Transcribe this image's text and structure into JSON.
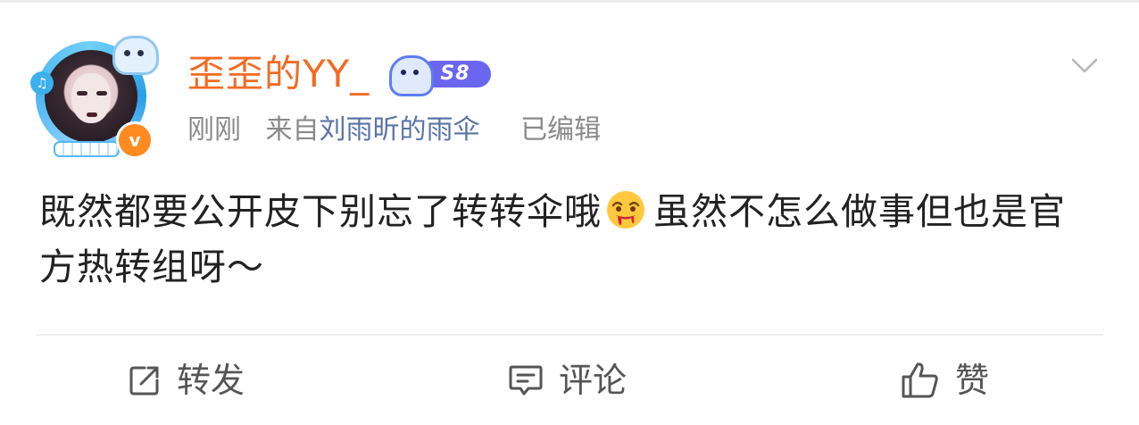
{
  "post": {
    "user": {
      "name": "歪歪的YY_",
      "level": "S8",
      "verified_badge": "v"
    },
    "meta": {
      "time": "刚刚",
      "from_prefix": "来自",
      "source": "刘雨昕的雨伞",
      "edited": "已编辑"
    },
    "content_part1": "既然都要公开皮下别忘了转转伞哦",
    "content_emoji": "drooling-face-emoji",
    "content_part2": "虽然不怎么做事但也是官方热转组呀～",
    "actions": {
      "repost_label": "转发",
      "comment_label": "评论",
      "like_label": "赞"
    }
  },
  "colors": {
    "username": "#f26b22",
    "meta": "#8a8a8a",
    "source_link": "#5a74a6",
    "level_pill": "#6b66ef",
    "verified_badge": "#ff8a1f"
  },
  "icons": {
    "menu": "chevron-down-icon",
    "repost": "repost-icon",
    "comment": "comment-icon",
    "like": "thumbs-up-icon"
  }
}
